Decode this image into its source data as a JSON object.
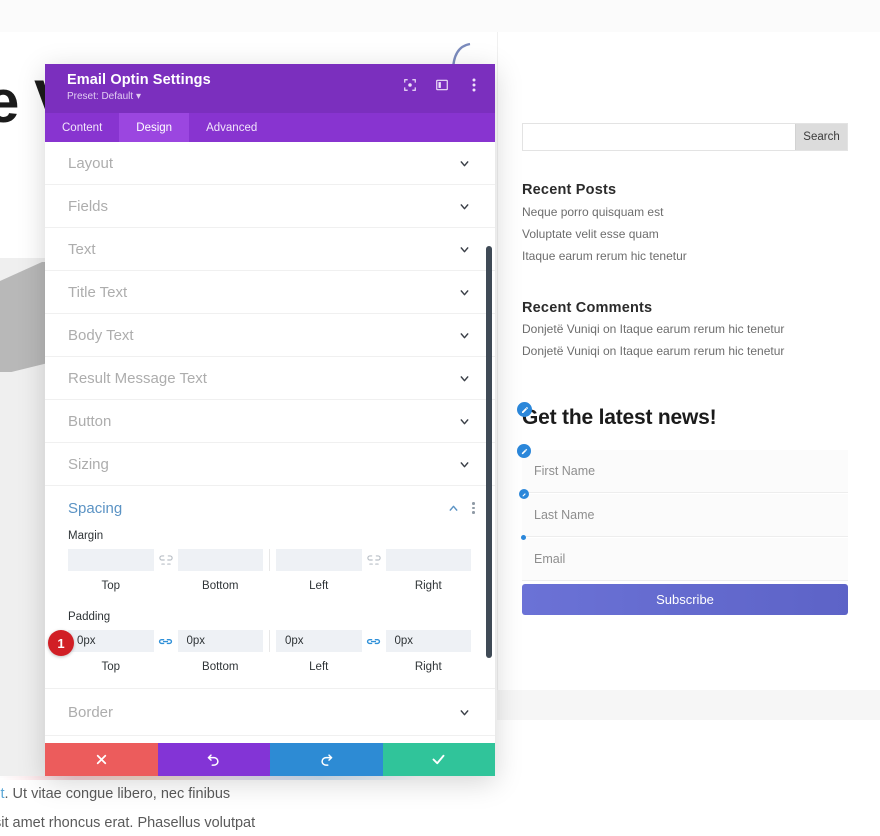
{
  "background": {
    "hero_word": "e V",
    "text_lines": [
      {
        "link": "lit",
        "rest": ". Ut vitae congue libero, nec finibus"
      },
      {
        "link": "",
        "rest": "sit amet rhoncus erat. Phasellus volutpat"
      }
    ]
  },
  "sidebar": {
    "search": {
      "value": "",
      "placeholder": "",
      "button_label": "Search"
    },
    "recent_posts": {
      "title": "Recent Posts",
      "items": [
        "Neque porro quisquam est",
        "Voluptate velit esse quam",
        "Itaque earum rerum hic tenetur"
      ]
    },
    "recent_comments": {
      "title": "Recent Comments",
      "items": [
        "Donjetë Vuniqi on Itaque earum rerum hic tenetur",
        "Donjetë Vuniqi on Itaque earum rerum hic tenetur"
      ]
    },
    "optin": {
      "title": "Get the latest news!",
      "fields": [
        {
          "placeholder": "First Name"
        },
        {
          "placeholder": "Last Name"
        },
        {
          "placeholder": "Email"
        }
      ],
      "submit_label": "Subscribe"
    }
  },
  "modal": {
    "title": "Email Optin Settings",
    "preset": "Preset: Default",
    "header_icons": [
      "focus-icon",
      "panel-layout-icon",
      "kebab-menu-icon"
    ],
    "tabs": [
      {
        "label": "Content",
        "active": false
      },
      {
        "label": "Design",
        "active": true
      },
      {
        "label": "Advanced",
        "active": false
      }
    ],
    "sections_top": [
      {
        "label": "Layout"
      },
      {
        "label": "Fields"
      },
      {
        "label": "Text"
      },
      {
        "label": "Title Text"
      },
      {
        "label": "Body Text"
      },
      {
        "label": "Result Message Text"
      },
      {
        "label": "Button"
      },
      {
        "label": "Sizing"
      }
    ],
    "spacing": {
      "title": "Spacing",
      "margin": {
        "label": "Margin",
        "linked": false,
        "values": [
          "",
          "",
          "",
          ""
        ],
        "captions": [
          "Top",
          "Bottom",
          "Left",
          "Right"
        ]
      },
      "padding": {
        "label": "Padding",
        "linked": true,
        "values": [
          "0px",
          "0px",
          "0px",
          "0px"
        ],
        "captions": [
          "Top",
          "Bottom",
          "Left",
          "Right"
        ]
      }
    },
    "sections_bottom": [
      {
        "label": "Border"
      }
    ],
    "footer": [
      {
        "name": "cancel",
        "icon": "close-icon",
        "color": "#ec5c5c"
      },
      {
        "name": "undo",
        "icon": "undo-icon",
        "color": "#8334d6"
      },
      {
        "name": "redo",
        "icon": "redo-icon",
        "color": "#2d8bd4"
      },
      {
        "name": "save",
        "icon": "check-icon",
        "color": "#30c49a"
      }
    ],
    "annotation_badge": "1"
  },
  "colors": {
    "header_purple": "#7b2fbe",
    "tabbar_purple": "#8834d0",
    "active_tab_purple": "#9b46e0",
    "spacing_accent": "#5b93c4",
    "badge_red": "#d11f25",
    "subscribe_blue": "#6b72d6"
  }
}
